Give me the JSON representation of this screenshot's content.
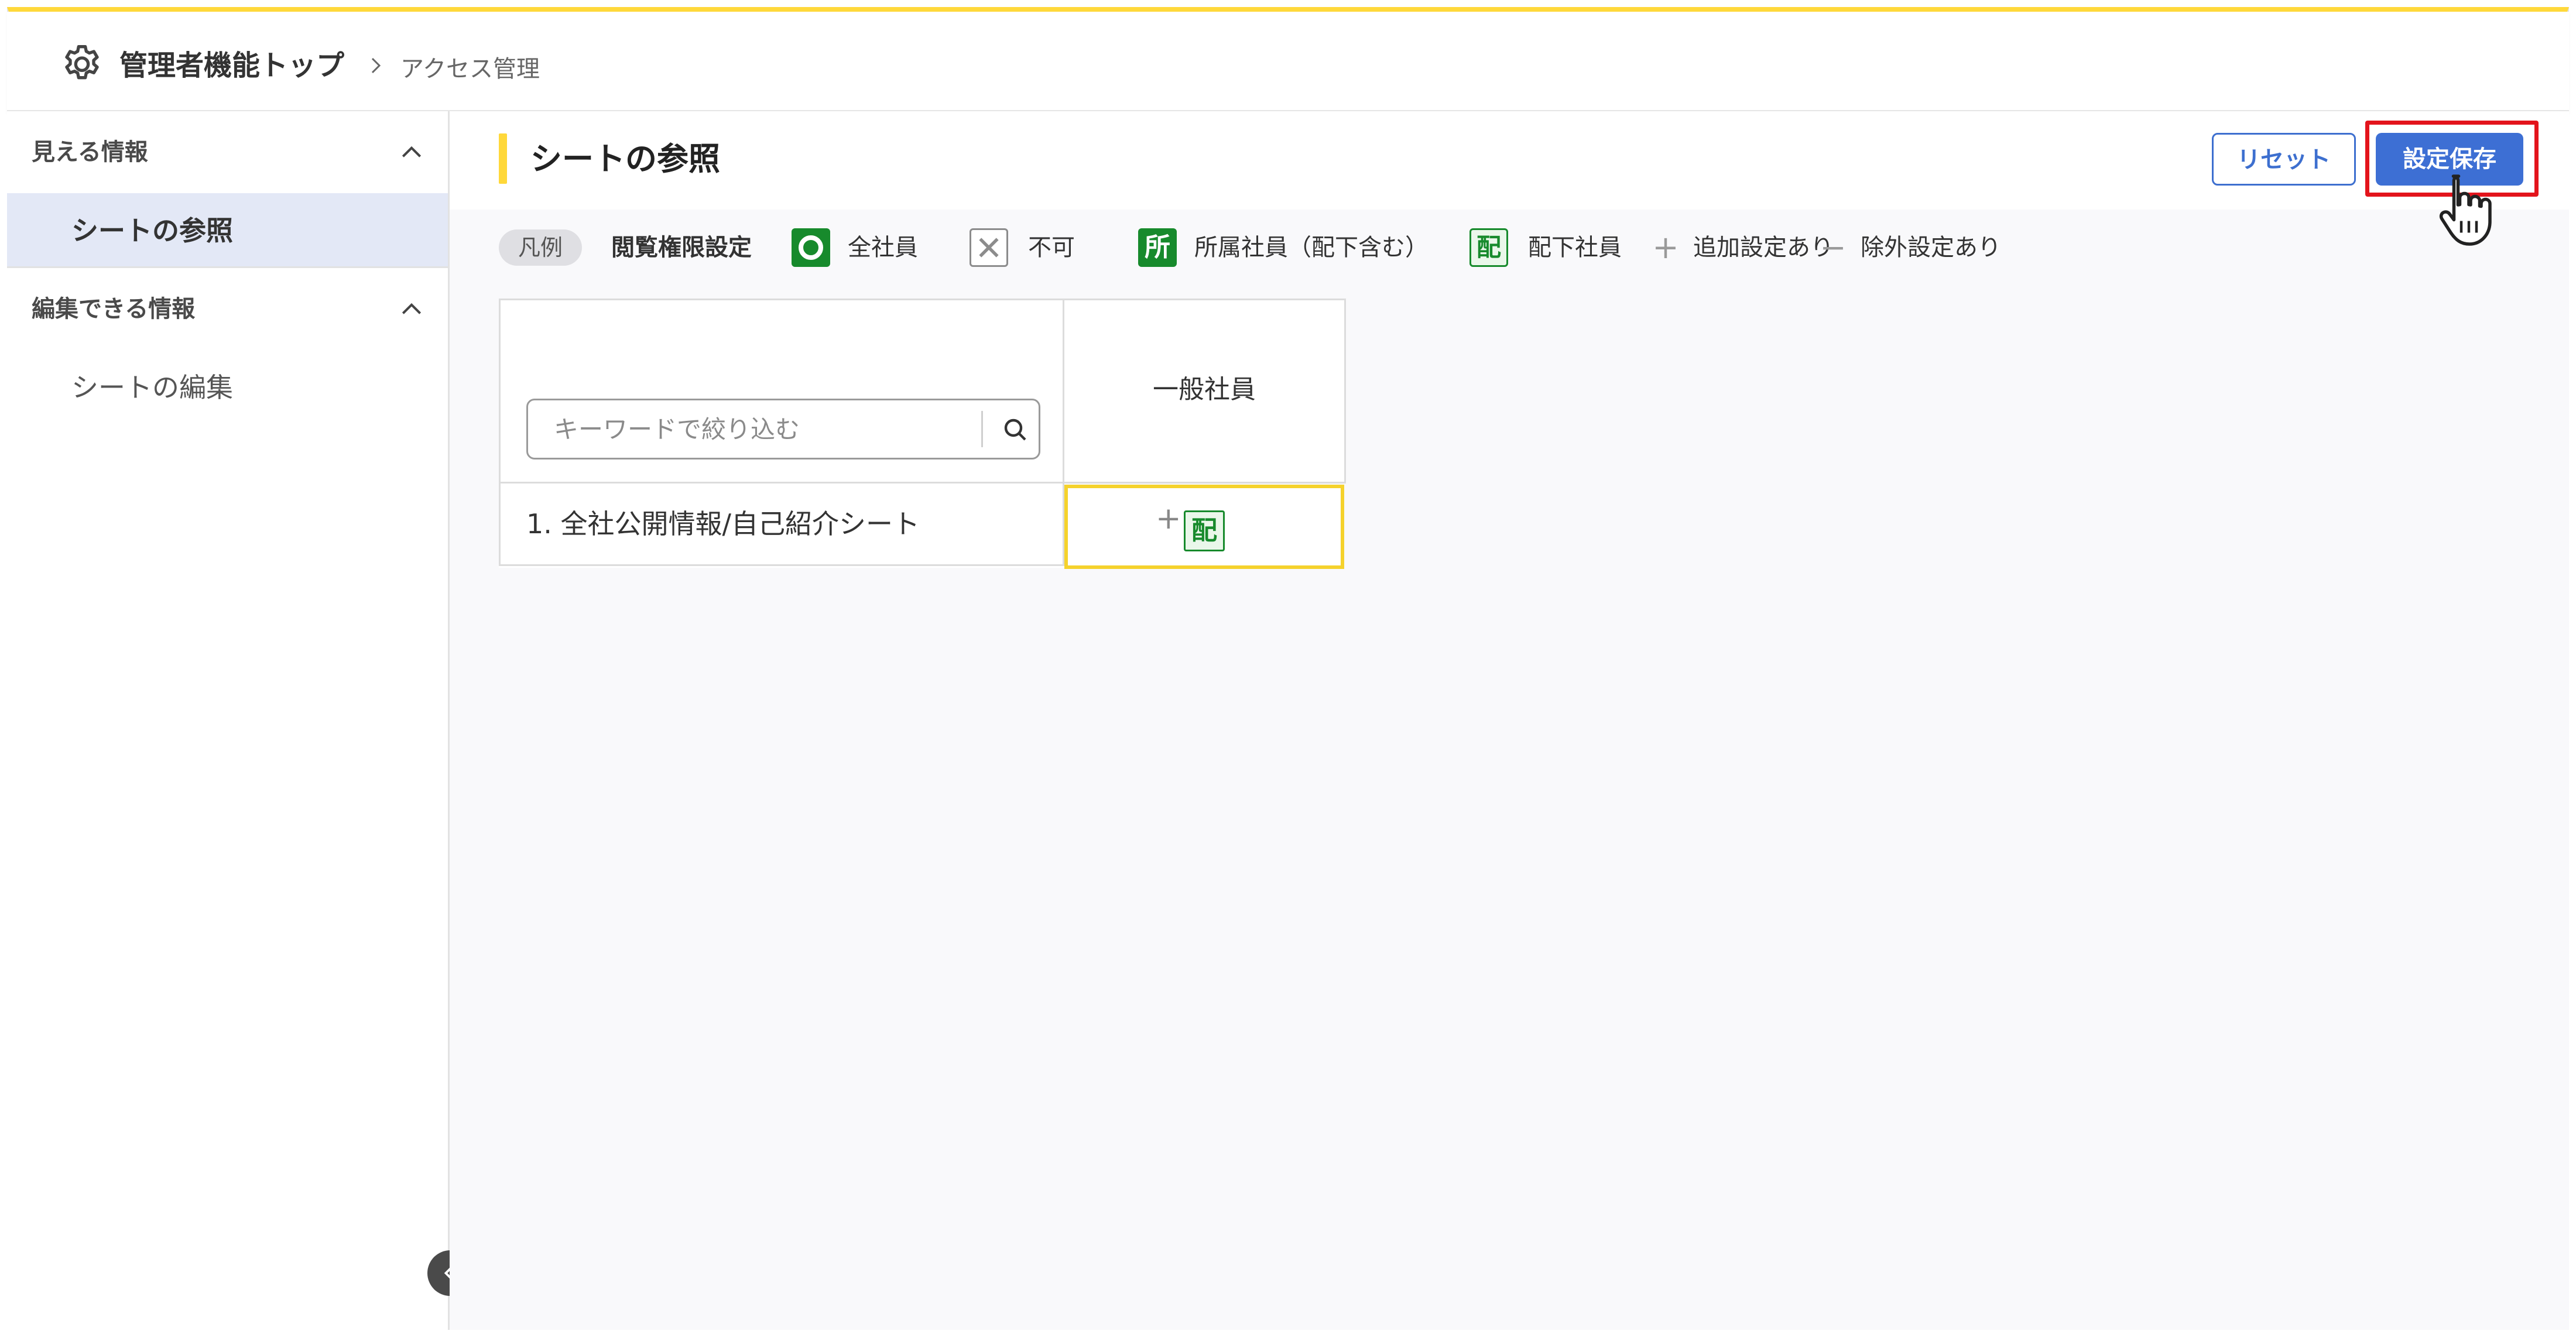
{
  "header": {
    "home_label": "管理者機能トップ",
    "current_label": "アクセス管理"
  },
  "sidebar": {
    "sections": [
      {
        "label": "見える情報",
        "items": [
          {
            "label": "シートの参照",
            "active": true
          }
        ]
      },
      {
        "label": "編集できる情報",
        "items": [
          {
            "label": "シートの編集",
            "active": false
          }
        ]
      }
    ]
  },
  "main": {
    "title": "シートの参照",
    "reset_label": "リセット",
    "save_label": "設定保存"
  },
  "legend": {
    "chip": "凡例",
    "title": "閲覧権限設定",
    "items": [
      {
        "icon": "circle-icon",
        "label": "全社員"
      },
      {
        "icon": "cross-icon",
        "label": "不可"
      },
      {
        "icon": "dept-icon",
        "glyph": "所",
        "label": "所属社員（配下含む）"
      },
      {
        "icon": "subordinate-icon",
        "glyph": "配",
        "label": "配下社員"
      },
      {
        "icon": "plus-icon",
        "glyph": "+",
        "label": "追加設定あり"
      },
      {
        "icon": "minus-icon",
        "glyph": "−",
        "label": "除外設定あり"
      }
    ]
  },
  "table": {
    "search_placeholder": "キーワードで絞り込む",
    "columns": [
      "一般社員"
    ],
    "rows": [
      {
        "label": "1. 全社公開情報/自己紹介シート",
        "cells": [
          {
            "prefix": "+",
            "badge": "配"
          }
        ]
      }
    ]
  },
  "colors": {
    "accent_yellow": "#ffd83a",
    "primary_blue": "#3d6fd4",
    "highlight_red": "#e3141c",
    "permission_green": "#178a2c"
  }
}
